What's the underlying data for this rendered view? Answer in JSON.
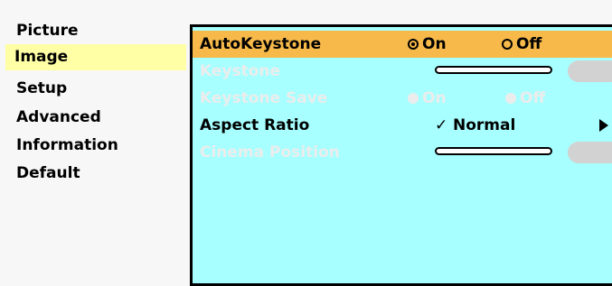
{
  "sidebar": {
    "items": [
      {
        "label": "Picture"
      },
      {
        "label": "Image"
      },
      {
        "label": "Setup"
      },
      {
        "label": "Advanced"
      },
      {
        "label": "Information"
      },
      {
        "label": "Default"
      }
    ]
  },
  "panel": {
    "auto_keystone": {
      "label": "AutoKeystone",
      "on_label": "On",
      "off_label": "Off",
      "selected": "On"
    },
    "keystone": {
      "label": "Keystone"
    },
    "keystone_save": {
      "label": "Keystone Save",
      "on_label": "On",
      "off_label": "Off"
    },
    "aspect_ratio": {
      "label": "Aspect Ratio",
      "check": "✓",
      "value": "Normal"
    },
    "cinema_position": {
      "label": "Cinema Position"
    }
  },
  "colors": {
    "panel_bg": "#a7ffff",
    "highlight_row": "#f6b94a",
    "sidebar_selected": "#ffffa6",
    "disabled_text": "#ececec"
  }
}
